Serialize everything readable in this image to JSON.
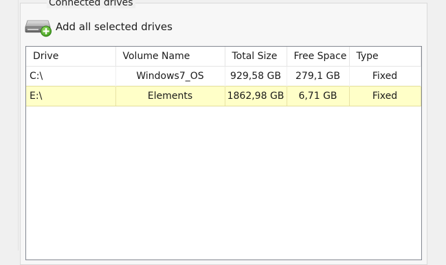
{
  "group": {
    "legend": "Connected drives"
  },
  "toolbar": {
    "add_all_label": "Add all selected drives"
  },
  "table": {
    "columns": [
      "Drive",
      "Volume Name",
      "Total Size",
      "Free Space",
      "Type"
    ],
    "rows": [
      {
        "drive": "C:\\",
        "volume": "Windows7_OS",
        "total": "929,58 GB",
        "free": "279,1 GB",
        "type": "Fixed",
        "selected": false
      },
      {
        "drive": "E:\\",
        "volume": "Elements",
        "total": "1862,98 GB",
        "free": "6,71 GB",
        "type": "Fixed",
        "selected": true
      }
    ]
  },
  "colors": {
    "selected_row": "#ffffc8",
    "window_bg": "#f0f0f0",
    "icon_green": "#5cb82f"
  },
  "icons": {
    "add_drives": "hard-drive-with-plus-icon"
  }
}
